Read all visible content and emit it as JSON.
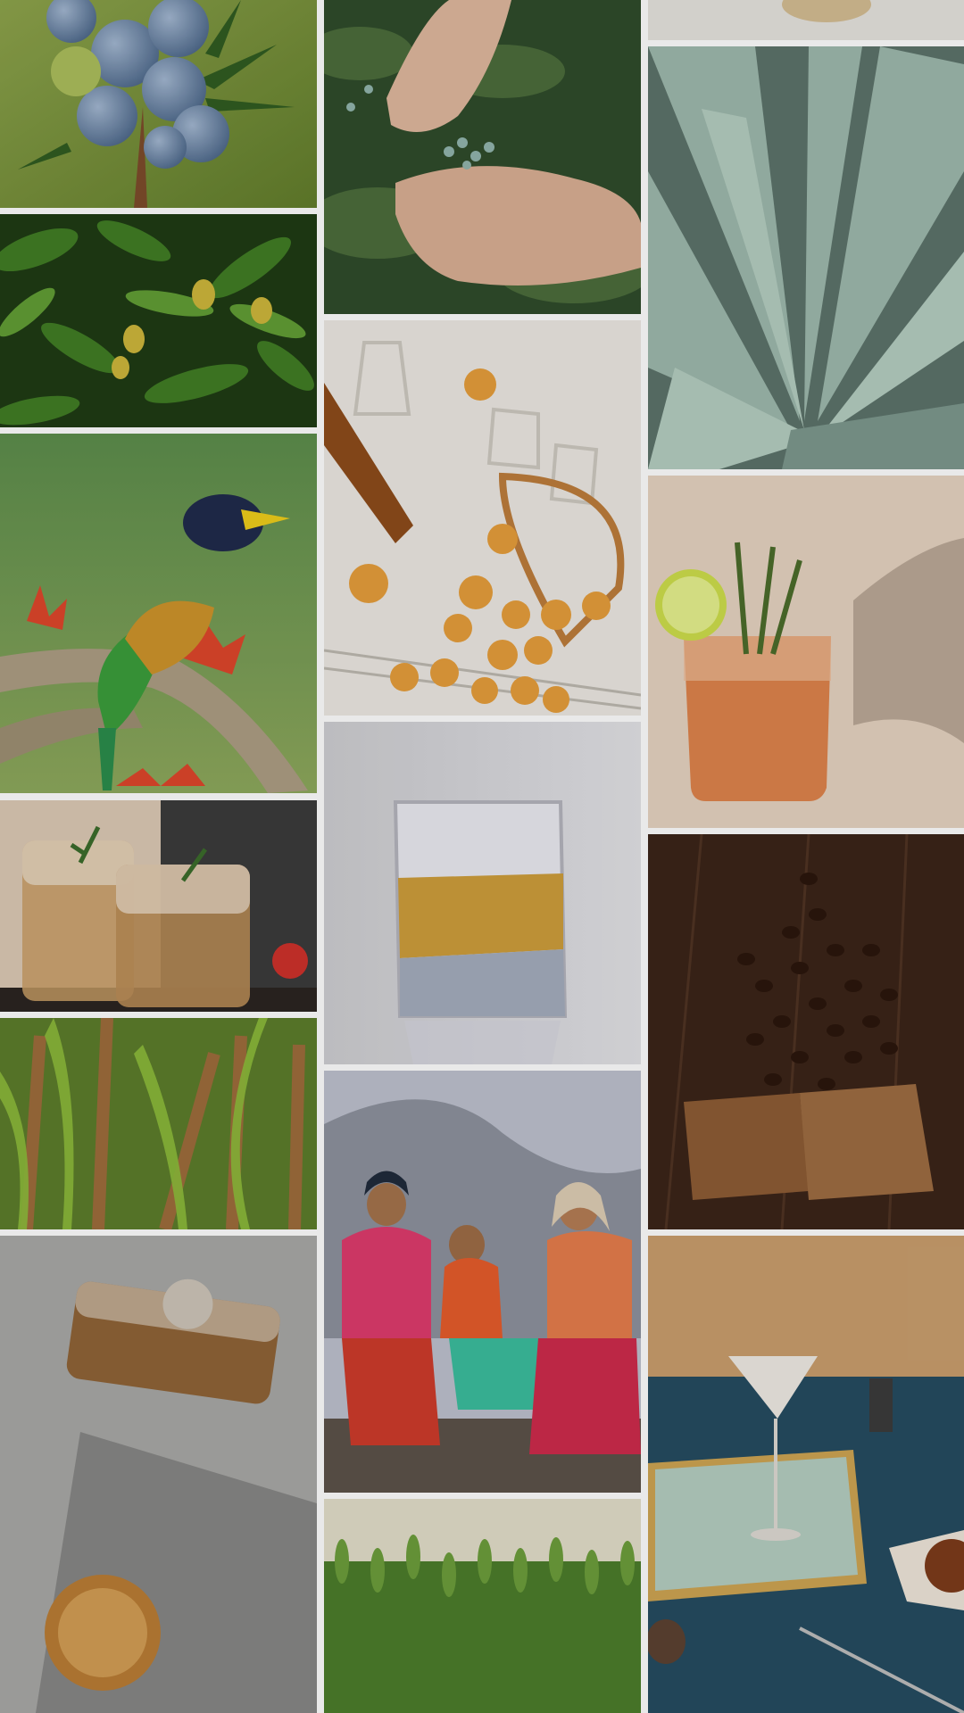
{
  "gallery": {
    "columns": [
      {
        "tiles": [
          {
            "subject": "blue-juniper-berries-branch"
          },
          {
            "subject": "mango-tree-with-fruit"
          },
          {
            "subject": "colorful-barbet-bird-on-flowering-branch"
          },
          {
            "subject": "two-iced-drinks-with-rosemary"
          },
          {
            "subject": "sugarcane-field"
          },
          {
            "subject": "whisky-decanter-and-glass-on-concrete"
          }
        ]
      },
      {
        "tiles": [
          {
            "subject": "hands-picking-juniper-berries"
          },
          {
            "subject": "apricots-glasses-bottle-on-linen"
          },
          {
            "subject": "whisky-in-glass-on-white"
          },
          {
            "subject": "three-women-sitting-mountains"
          },
          {
            "subject": "green-wheat-field"
          }
        ]
      },
      {
        "tiles": [
          {
            "subject": "top-partial-image"
          },
          {
            "subject": "agave-plant"
          },
          {
            "subject": "orange-cocktail-with-lime-and-rosemary"
          },
          {
            "subject": "coffee-beans-on-wood"
          },
          {
            "subject": "martini-glass-on-tray-blue-table"
          }
        ]
      }
    ]
  },
  "colors": {
    "background": "#e9e9e9",
    "berry_blue": "#6b86a8",
    "leaf_green": "#3c6a2a",
    "bird_orange": "#e07a2a",
    "whisky_amber": "#c89a3a",
    "cocktail_orange": "#d8804a",
    "coffee_brown": "#4a2a18",
    "table_blue": "#254a5e",
    "agave_green": "#8fa89c"
  }
}
